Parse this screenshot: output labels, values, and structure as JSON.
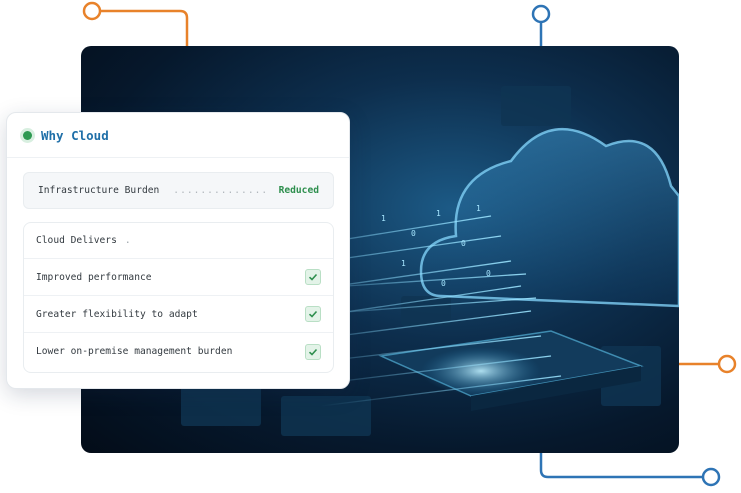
{
  "card": {
    "title": "Why Cloud",
    "burden": {
      "label": "Infrastructure Burden",
      "leader": "..............",
      "value": "Reduced"
    },
    "delivers": {
      "heading": "Cloud Delivers",
      "heading_mark": ".",
      "items": [
        {
          "label": "Improved performance",
          "checked": true
        },
        {
          "label": "Greater flexibility to adapt",
          "checked": true
        },
        {
          "label": "Lower on-premise management burden",
          "checked": true
        }
      ]
    }
  },
  "hero": {
    "binary": [
      "1",
      "0",
      "1",
      "0",
      "1",
      "0",
      "1",
      "0"
    ]
  },
  "colors": {
    "orange_connector": "#e8822a",
    "blue_connector": "#2e74b5",
    "title": "#1f6fa8",
    "success": "#2e8f4e"
  },
  "icons": [
    "check-icon",
    "status-dot-icon"
  ]
}
